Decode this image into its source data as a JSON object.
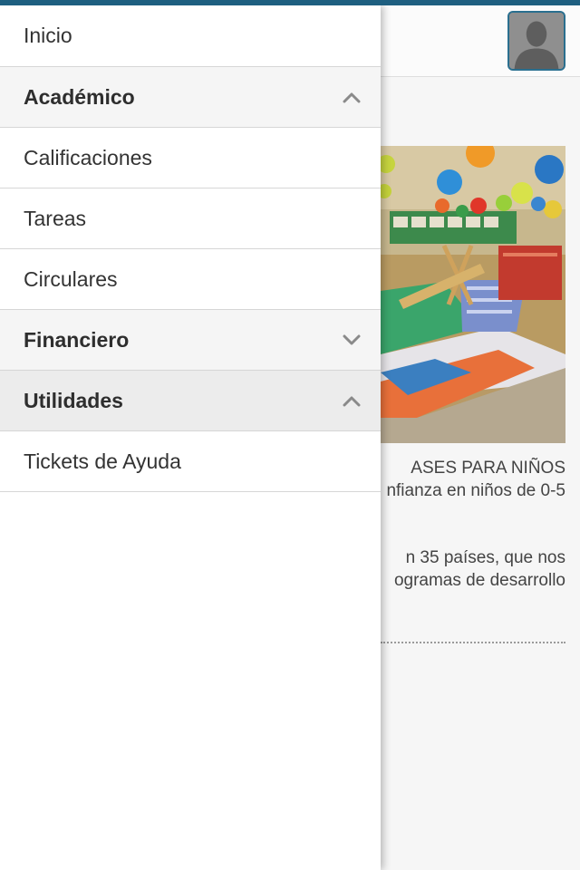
{
  "page": {
    "text_lines": [
      "ASES PARA NIÑOS",
      "nfianza en niños de 0-5",
      "n 35 países, que nos",
      "ogramas de desarrollo"
    ],
    "hero_image": "children-play-gym-balloons",
    "avatar_icon": "user-avatar-icon"
  },
  "colors": {
    "top_bar": "#1e5f80",
    "avatar_border": "#2a6f8f",
    "section_bg": "#f5f5f5",
    "active_section_bg": "#ececec"
  },
  "menu": {
    "items": [
      {
        "label": "Inicio",
        "type": "item"
      },
      {
        "label": "Académico",
        "type": "section",
        "icon": "chevron-up-icon"
      },
      {
        "label": "Calificaciones",
        "type": "item"
      },
      {
        "label": "Tareas",
        "type": "item"
      },
      {
        "label": "Circulares",
        "type": "item"
      },
      {
        "label": "Financiero",
        "type": "section",
        "icon": "chevron-down-icon"
      },
      {
        "label": "Utilidades",
        "type": "section",
        "icon": "chevron-up-icon"
      },
      {
        "label": "Tickets de Ayuda",
        "type": "item"
      }
    ]
  }
}
